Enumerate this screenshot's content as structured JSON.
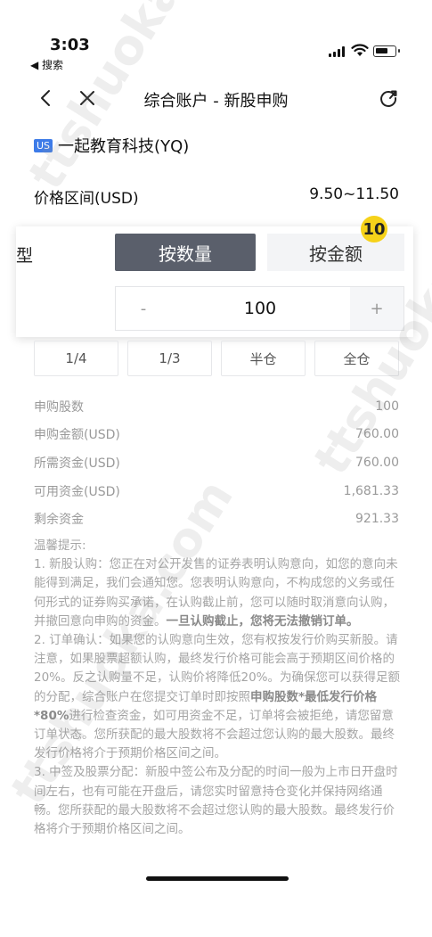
{
  "status_bar": {
    "time": "3:03",
    "back_app": "◀ 搜索"
  },
  "nav": {
    "title": "综合账户 - 新股申购"
  },
  "stock": {
    "market_badge": "US",
    "name": "一起教育科技(YQ)"
  },
  "price_range": {
    "label": "价格区间(USD)",
    "value": "9.50~11.50"
  },
  "order_panel": {
    "type_label": "型",
    "mode_quantity": "按数量",
    "mode_amount": "按金额",
    "step_badge": "10",
    "minus": "-",
    "quantity": "100",
    "plus": "+"
  },
  "fractions": [
    "1/4",
    "1/3",
    "半仓",
    "全仓"
  ],
  "details": [
    {
      "label": "申购股数",
      "value": "100"
    },
    {
      "label": "申购金额(USD)",
      "value": "760.00"
    },
    {
      "label": "所需资金(USD)",
      "value": "760.00"
    },
    {
      "label": "可用资金(USD)",
      "value": "1,681.33"
    },
    {
      "label": "剩余资金",
      "value": "921.33"
    }
  ],
  "tips": {
    "title": "温馨提示:",
    "p1": "1. 新股认购：您正在对公开发售的证券表明认购意向，如您的意向未能得到满足，我们会通知您。您表明认购意向，不构成您的义务或任何形式的证券购买承诺，在认购截止前，您可以随时取消意向认购，并撤回意向申购的资金。",
    "p1_bold": "一旦认购截止，您将无法撤销订单。",
    "p2a": "2. 订单确认：如果您的认购意向生效，您有权按发行价购买新股。请注意，如果股票超额认购，最终发行价格可能会高于预期区间价格的20%。反之认购量不足，认购价将降低20%。为确保您可以获得足额的分配，综合账户在您提交订单时即按照",
    "p2_bold": "申购股数*最低发行价格*80%",
    "p2b": "进行检查资金，如可用资金不足，订单将会被拒绝，请您留意订单状态。您所获配的最大股数将不会超过您认购的最大股数。最终发行价格将介于预期价格区间之间。",
    "p3": "3. 中签及股票分配：新股中签公布及分配的时间一般为上市日开盘时间左右，也有可能在开盘后，请您实时留意持仓变化并保持网络通畅。您所获配的最大股数将不会超过您认购的最大股数。最终发行价格将介于预期价格区间之间。"
  },
  "watermark": {
    "text": "ttshuoka.com"
  }
}
